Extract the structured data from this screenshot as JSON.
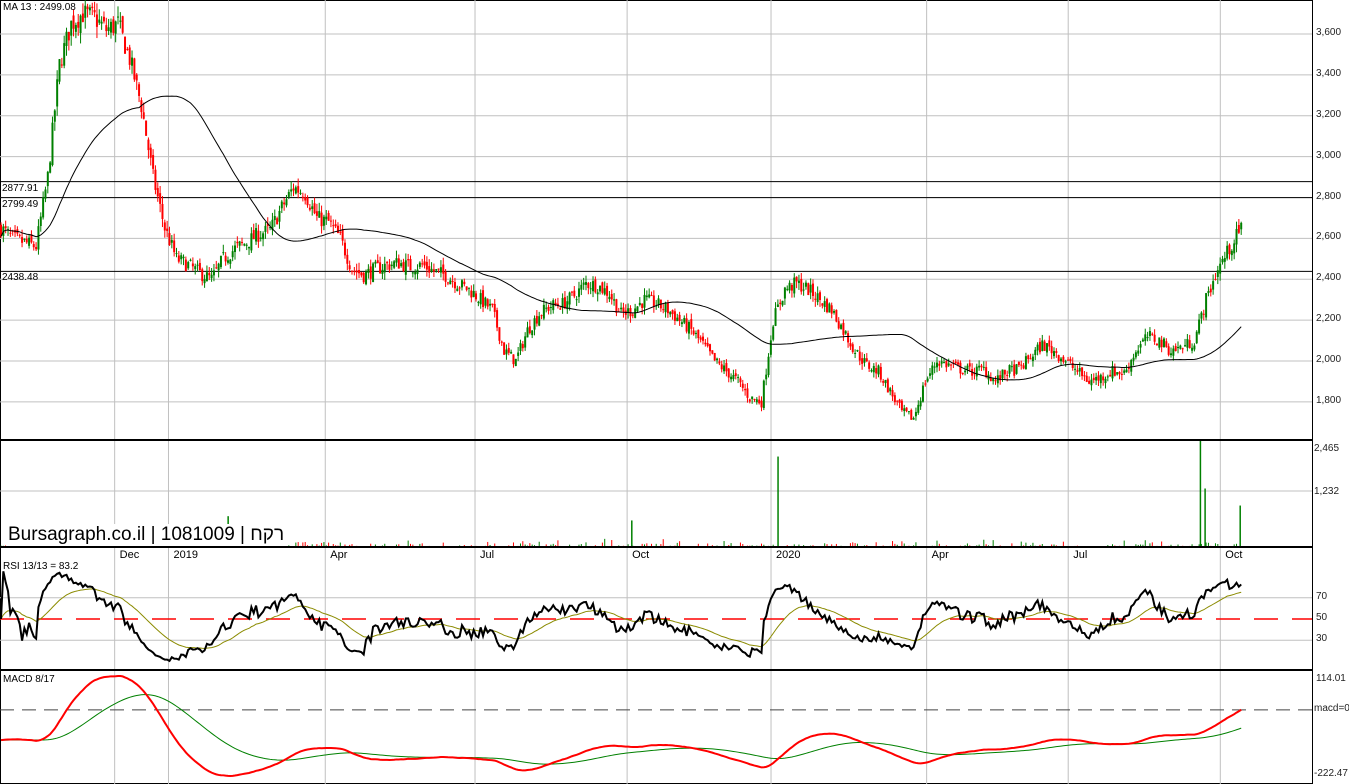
{
  "header": {
    "ma_label": "MA 13 : 2499.08",
    "brand": "Bursagraph.co.il | 1081009 | רקח",
    "rsi_label": "RSI 13/13 = 83.2",
    "macd_label": "MACD 8/17"
  },
  "colors": {
    "up": "#008000",
    "down": "#ff0000",
    "grid": "#c0c0c0",
    "signal": "#8b8b00"
  },
  "chart_data": [
    {
      "type": "candlestick",
      "title": "MA 13 : 2499.08",
      "ylim": [
        1620,
        3780
      ],
      "y_ticks": [
        "3,600",
        "3,400",
        "3,200",
        "3,000",
        "2,800",
        "2,600",
        "2,400",
        "2,200",
        "2,000",
        "1,800"
      ],
      "y_tick_values": [
        3600,
        3400,
        3200,
        3000,
        2800,
        2600,
        2400,
        2200,
        2000,
        1800
      ],
      "x_ticks": [
        "Dec",
        "2019",
        "Apr",
        "Jul",
        "Oct",
        "2020",
        "Apr",
        "Jul",
        "Oct"
      ],
      "x_tick_weeks": [
        9.8,
        14.4,
        27.8,
        40.6,
        53.6,
        65.9,
        79.2,
        91.3,
        104.3
      ],
      "levels": [
        {
          "value": 2877.91,
          "label": "2877.91"
        },
        {
          "value": 2799.49,
          "label": "2799.49"
        },
        {
          "value": 2438.48,
          "label": "2438.48"
        }
      ],
      "weekly_close": [
        2650,
        2600,
        2580,
        2560,
        2900,
        3450,
        3650,
        3700,
        3680,
        3620,
        3650,
        3480,
        3250,
        2900,
        2650,
        2500,
        2470,
        2430,
        2400,
        2500,
        2550,
        2580,
        2620,
        2640,
        2750,
        2850,
        2820,
        2700,
        2680,
        2600,
        2450,
        2420,
        2450,
        2470,
        2480,
        2460,
        2470,
        2440,
        2420,
        2380,
        2350,
        2300,
        2250,
        2050,
        2000,
        2150,
        2230,
        2270,
        2280,
        2320,
        2380,
        2370,
        2330,
        2230,
        2250,
        2300,
        2280,
        2250,
        2200,
        2150,
        2080,
        2000,
        1950,
        1900,
        1820,
        1800,
        2200,
        2350,
        2380,
        2350,
        2300,
        2250,
        2150,
        2050,
        1980,
        1950,
        1850,
        1750,
        1720,
        1900,
        2000,
        1980,
        1960,
        1950,
        1960,
        1900,
        1950,
        1960,
        2020,
        2080,
        2050,
        2000,
        1950,
        1900,
        1920,
        1950,
        1940,
        2050,
        2120,
        2100,
        2050,
        2070,
        2100,
        2300,
        2450,
        2550,
        2650
      ],
      "ma_period": 13,
      "ma_last": 2499.08
    },
    {
      "type": "bar",
      "title": "Volume",
      "y_ticks": [
        "2,465",
        "1,232"
      ],
      "y_tick_values": [
        2465,
        1232
      ],
      "spikes": [
        {
          "week": 66.5,
          "value": 2100
        },
        {
          "week": 102.6,
          "value": 2465
        },
        {
          "week": 103,
          "value": 1350
        },
        {
          "week": 106,
          "value": 950
        },
        {
          "week": 19.5,
          "value": 700
        },
        {
          "week": 54,
          "value": 600
        }
      ]
    },
    {
      "type": "line",
      "title": "RSI 13/13 = 83.2",
      "ylim": [
        0,
        100
      ],
      "y_ticks": [
        "70",
        "50",
        "30"
      ],
      "y_tick_values": [
        70,
        50,
        30
      ],
      "last": 83.2
    },
    {
      "type": "line",
      "title": "MACD 8/17",
      "y_ticks": [
        "114.01",
        "macd=0",
        "-222.47"
      ],
      "ylim": [
        -222.47,
        114.01
      ]
    }
  ]
}
